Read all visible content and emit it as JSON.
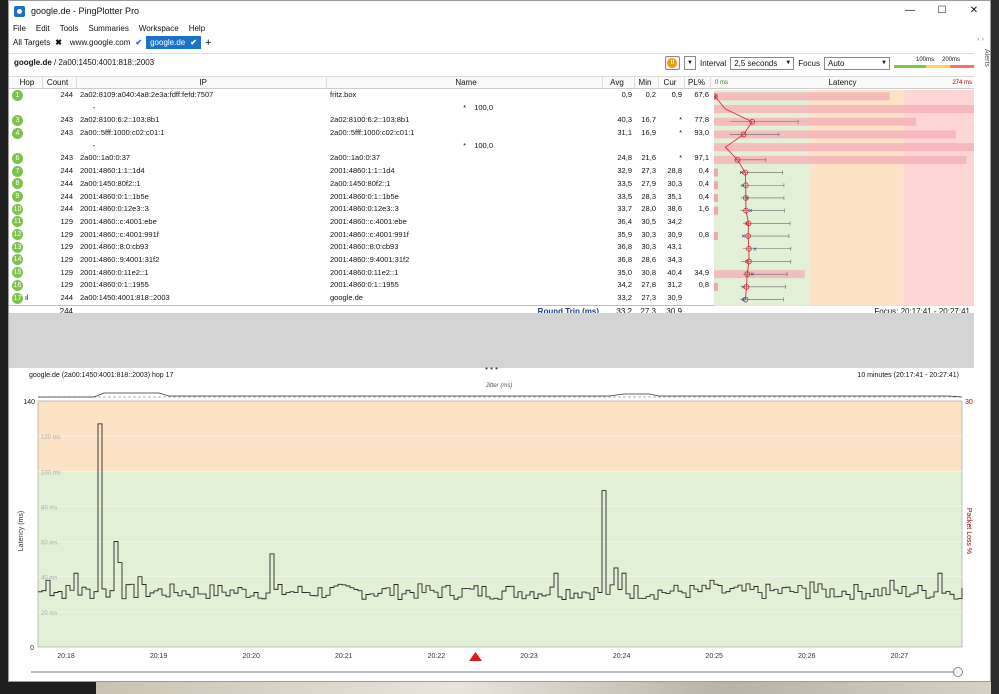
{
  "window": {
    "title": "google.de - PingPlotter Pro",
    "minimize": "—",
    "maximize": "☐",
    "close": "✕"
  },
  "menu": [
    "File",
    "Edit",
    "Tools",
    "Summaries",
    "Workspace",
    "Help"
  ],
  "tabs": [
    {
      "label": "All Targets",
      "marker": "✖"
    },
    {
      "label": "www.google.com",
      "marker": "✔"
    },
    {
      "label": "google.de",
      "marker": "✔"
    }
  ],
  "tab_add": "+",
  "tab_nav": "‹ ›",
  "breadcrumb": {
    "target": "google.de",
    "ip": " / 2a00:1450:4001:818::2003"
  },
  "toolbar": {
    "interval_label": "Interval",
    "interval_value": "2,5 seconds",
    "focus_label": "Focus",
    "focus_value": "Auto",
    "threshold_1": "100ms",
    "threshold_2": "200ms"
  },
  "alerts_label": "Alerts",
  "table": {
    "headers": {
      "hop": "Hop",
      "count": "Count",
      "ip": "IP",
      "name": "Name",
      "avg": "Avg",
      "min": "Min",
      "cur": "Cur",
      "pl": "PL%",
      "latency": "Latency",
      "lat_min": "0 ms",
      "lat_max": "274 ms"
    },
    "rows": [
      {
        "hop": "1",
        "count": "244",
        "ip": "2a02:8109:a040:4a8:2e3a:fdff:fefd:7507",
        "name": "fritz.box",
        "avg": "0,9",
        "min": "0,2",
        "cur": "0,9",
        "pl": "67,6",
        "lat": 0.9,
        "plv": 67.6
      },
      {
        "hop": "",
        "count": "",
        "ip": "-",
        "name": "",
        "avg": "",
        "min": "",
        "cur": "*",
        "pl": "100,0",
        "lat": null,
        "plv": 100
      },
      {
        "hop": "3",
        "count": "243",
        "ip": "2a02:8100:6:2::103:8b1",
        "name": "2a02:8100:6:2::103:8b1",
        "avg": "40,3",
        "min": "16,7",
        "cur": "*",
        "pl": "77,8",
        "lat": 40.3,
        "plv": 77.8
      },
      {
        "hop": "4",
        "count": "243",
        "ip": "2a00::5fff:1000:c02:c01:1",
        "name": "2a00::5fff:1000:c02:c01:1",
        "avg": "31,1",
        "min": "16,9",
        "cur": "*",
        "pl": "93,0",
        "lat": 31.1,
        "plv": 93.0
      },
      {
        "hop": "",
        "count": "",
        "ip": "-",
        "name": "",
        "avg": "",
        "min": "",
        "cur": "*",
        "pl": "100,0",
        "lat": null,
        "plv": 100
      },
      {
        "hop": "6",
        "count": "243",
        "ip": "2a00::1a0:0:37",
        "name": "2a00::1a0:0:37",
        "avg": "24,8",
        "min": "21,6",
        "cur": "*",
        "pl": "97,1",
        "lat": 24.8,
        "plv": 97.1
      },
      {
        "hop": "7",
        "count": "244",
        "ip": "2001:4860:1:1::1d4",
        "name": "2001:4860:1:1::1d4",
        "avg": "32,9",
        "min": "27,3",
        "cur": "28,8",
        "pl": "0,4",
        "lat": 32.9,
        "plv": 0.4
      },
      {
        "hop": "8",
        "count": "244",
        "ip": "2a00:1450:80f2::1",
        "name": "2a00:1450:80f2::1",
        "avg": "33,5",
        "min": "27,9",
        "cur": "30,3",
        "pl": "0,4",
        "lat": 33.5,
        "plv": 0.4
      },
      {
        "hop": "9",
        "count": "244",
        "ip": "2001:4860:0:1::1b5e",
        "name": "2001:4860:0:1::1b5e",
        "avg": "33,5",
        "min": "28,3",
        "cur": "35,1",
        "pl": "0,4",
        "lat": 33.5,
        "plv": 0.4
      },
      {
        "hop": "10",
        "count": "244",
        "ip": "2001:4860:0:12e3::3",
        "name": "2001:4860:0:12e3::3",
        "avg": "33,7",
        "min": "28,0",
        "cur": "38,6",
        "pl": "1,6",
        "lat": 33.7,
        "plv": 1.6
      },
      {
        "hop": "11",
        "count": "129",
        "ip": "2001:4860::c:4001:ebe",
        "name": "2001:4860::c:4001:ebe",
        "avg": "36,4",
        "min": "30,5",
        "cur": "34,2",
        "pl": "",
        "lat": 36.4,
        "plv": 0
      },
      {
        "hop": "12",
        "count": "129",
        "ip": "2001:4860::c:4001:991f",
        "name": "2001:4860::c:4001:991f",
        "avg": "35,9",
        "min": "30,3",
        "cur": "30,9",
        "pl": "0,8",
        "lat": 35.9,
        "plv": 0.8
      },
      {
        "hop": "13",
        "count": "129",
        "ip": "2001:4860::8:0:cb93",
        "name": "2001:4860::8:0:cb93",
        "avg": "36,8",
        "min": "30,3",
        "cur": "43,1",
        "pl": "",
        "lat": 36.8,
        "plv": 0
      },
      {
        "hop": "14",
        "count": "129",
        "ip": "2001:4860::9:4001:31f2",
        "name": "2001:4860::9:4001:31f2",
        "avg": "36,8",
        "min": "28,6",
        "cur": "34,3",
        "pl": "",
        "lat": 36.8,
        "plv": 0
      },
      {
        "hop": "15",
        "count": "129",
        "ip": "2001:4860:0:11e2::1",
        "name": "2001:4860:0:11e2::1",
        "avg": "35,0",
        "min": "30,8",
        "cur": "40,4",
        "pl": "34,9",
        "lat": 35.0,
        "plv": 34.9
      },
      {
        "hop": "16",
        "count": "129",
        "ip": "2001:4860:0:1::1955",
        "name": "2001:4860:0:1::1955",
        "avg": "34,2",
        "min": "27,8",
        "cur": "31,2",
        "pl": "0,8",
        "lat": 34.2,
        "plv": 0.8
      },
      {
        "hop": "17",
        "count": "244",
        "ip": "2a00:1450:4001:818::2003",
        "name": "google.de",
        "avg": "33,2",
        "min": "27,3",
        "cur": "30,9",
        "pl": "",
        "lat": 33.2,
        "plv": 0
      }
    ],
    "summary": {
      "count": "244",
      "label": "Round Trip (ms)",
      "avg": "33,2",
      "min": "27,3",
      "cur": "30,9",
      "focus": "Focus: 20:17:41 - 20:27:41"
    }
  },
  "timeline": {
    "title": "google.de (2a00:1450:4001:818::2003) hop 17",
    "range": "10 minutes (20:17:41 - 20:27:41)",
    "jitter_label": "Jitter (ms)",
    "y_label": "Latency (ms)",
    "y2_label": "Packet Loss %",
    "y_top": "140",
    "y2_top": "30",
    "y_zero": "0",
    "y_ticks": [
      "120 ms",
      "100 ms",
      "80 ms",
      "60 ms",
      "40 ms",
      "20 ms"
    ],
    "x_ticks": [
      "20:18",
      "20:19",
      "20:20",
      "20:21",
      "20:22",
      "20:23",
      "20:24",
      "20:25",
      "20:26",
      "20:27"
    ],
    "colors": {
      "green": "#e2f1d6",
      "orange": "#fde3c6",
      "red": "#ffd6d6"
    }
  },
  "chart_data": {
    "type": "line",
    "title": "google.de (2a00:1450:4001:818::2003) hop 17",
    "ylabel": "Latency (ms)",
    "ylim": [
      0,
      140
    ],
    "x_categories": [
      "20:18",
      "20:19",
      "20:20",
      "20:21",
      "20:22",
      "20:23",
      "20:24",
      "20:25",
      "20:26",
      "20:27"
    ],
    "spikes": [
      {
        "time": "20:18.6",
        "ms": 127
      },
      {
        "time": "20:18.8",
        "ms": 60
      },
      {
        "time": "20:20.2",
        "ms": 53
      },
      {
        "time": "20:23.8",
        "ms": 89
      }
    ],
    "baseline_ms": 31
  }
}
